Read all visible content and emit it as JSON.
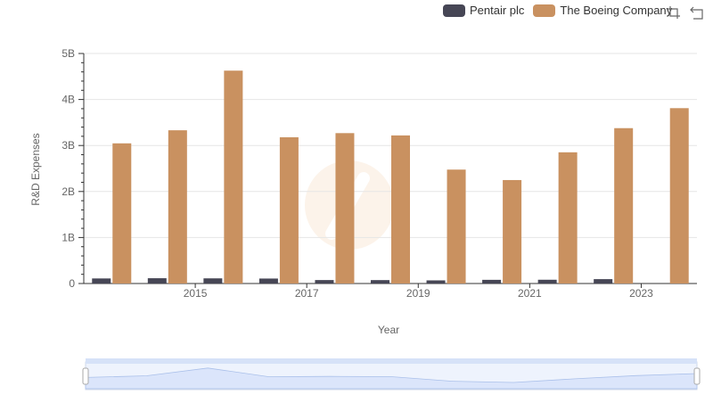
{
  "colors": {
    "pentair": "#464655",
    "boeing": "#c99160",
    "grid": "#e6e6e6",
    "zoom_fill": "#dbe5fb"
  },
  "toolbox": {
    "zoom_icon": "zoom-icon",
    "restore_icon": "restore-icon"
  },
  "chart_data": {
    "type": "bar",
    "x": [
      2014,
      2015,
      2016,
      2017,
      2018,
      2019,
      2020,
      2021,
      2022,
      2023,
      2024
    ],
    "x_tick_labels": [
      "2015",
      "2017",
      "2019",
      "2021",
      "2023"
    ],
    "y_tick_labels": [
      "0",
      "1B",
      "2B",
      "3B",
      "4B",
      "5B"
    ],
    "xlabel": "Year",
    "ylabel": "R&D Expenses",
    "ylim": [
      0,
      5000000000
    ],
    "series": [
      {
        "name": "Pentair plc",
        "color": "#464655",
        "values": [
          110000000,
          115000000,
          112000000,
          108000000,
          75000000,
          74000000,
          68000000,
          80000000,
          82000000,
          95000000,
          null
        ]
      },
      {
        "name": "The Boeing Company",
        "color": "#c99160",
        "values": [
          3047000000,
          3331000000,
          4627000000,
          3179000000,
          3269000000,
          3219000000,
          2476000000,
          2249000000,
          2852000000,
          3377000000,
          3812000000
        ]
      }
    ],
    "legend": "top-right",
    "grid": true
  }
}
